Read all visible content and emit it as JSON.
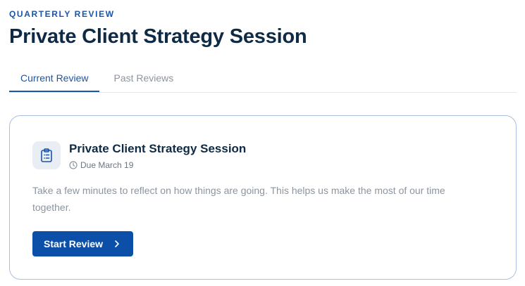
{
  "header": {
    "eyebrow": "QUARTERLY REVIEW",
    "title": "Private Client Strategy Session"
  },
  "tabs": [
    {
      "label": "Current Review",
      "active": true
    },
    {
      "label": "Past Reviews",
      "active": false
    }
  ],
  "card": {
    "icon": "clipboard-list-icon",
    "title": "Private Client Strategy Session",
    "due_icon": "clock-icon",
    "due": "Due March 19",
    "description": "Take a few minutes to reflect on how things are going. This helps us make the most of our time together.",
    "button_label": "Start Review",
    "button_icon": "chevron-right-icon"
  },
  "colors": {
    "accent": "#1a55a8",
    "button": "#0b4fa8",
    "title": "#0f2a44",
    "muted": "#8b95a1",
    "card_border": "#a9c0de"
  }
}
